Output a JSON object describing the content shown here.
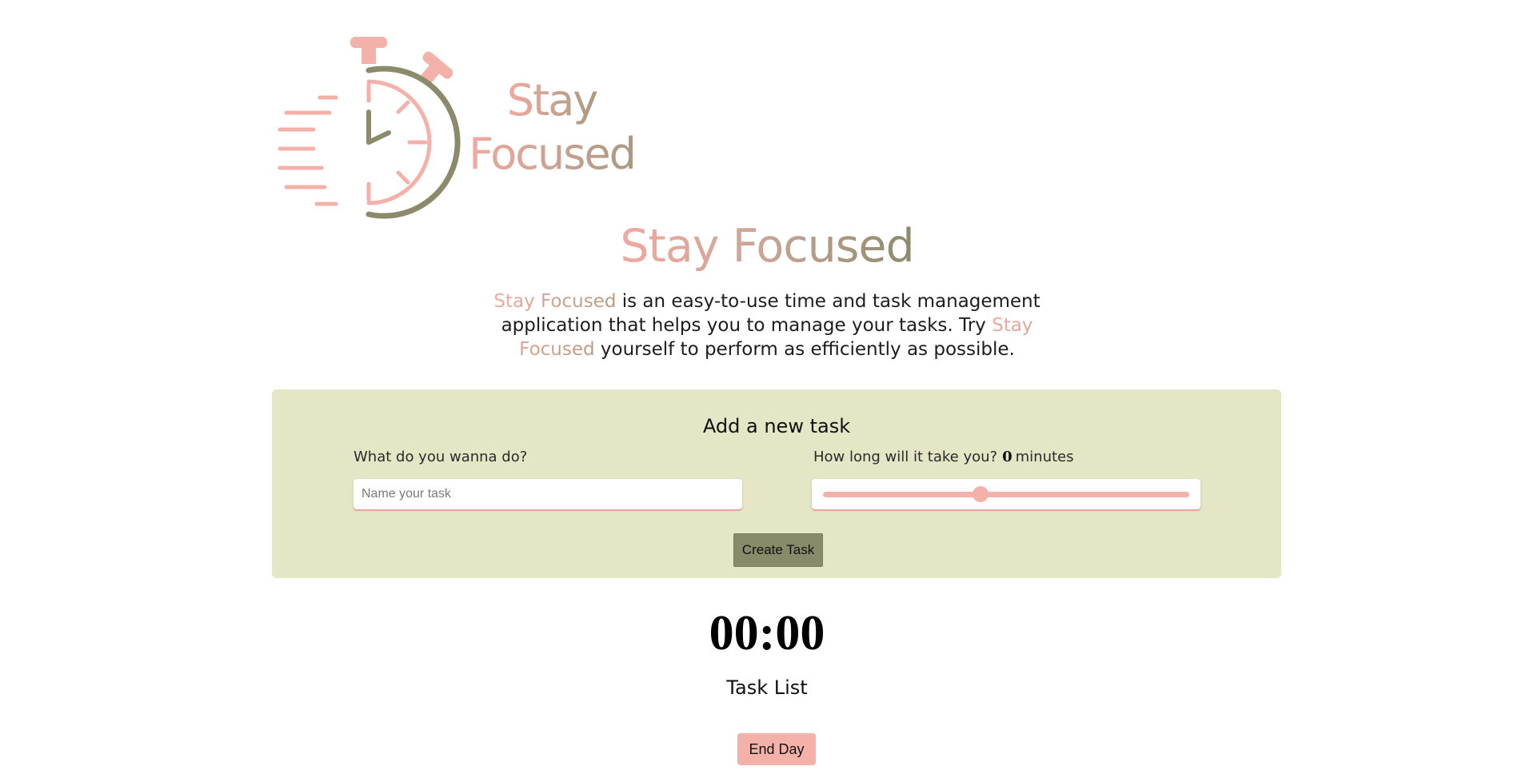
{
  "brand": {
    "logo_line1": "Stay",
    "logo_line2": "Focused",
    "title": "Stay Focused",
    "colors": {
      "pink": "#f2a9a0",
      "tan": "#c9a596",
      "olive": "#8b8a6b",
      "panel": "#e5e6c6"
    }
  },
  "intro": {
    "brand_name": "Stay Focused",
    "text_a": " is an easy-to-use time and task management application that helps you to manage your tasks. Try ",
    "brand_name_2": "Stay Focused",
    "text_b": " yourself to perform as efficiently as possible."
  },
  "task_form": {
    "title": "Add a new task",
    "name_label": "What do you wanna do?",
    "name_placeholder": "Name your task",
    "name_value": "",
    "duration_label": "How long will it take you?",
    "duration_value": "0",
    "duration_unit": "minutes",
    "slider_level": 0.43,
    "create_label": "Create Task"
  },
  "timer": {
    "display": "00:00"
  },
  "task_list": {
    "title": "Task List"
  },
  "end_day_label": "End Day"
}
